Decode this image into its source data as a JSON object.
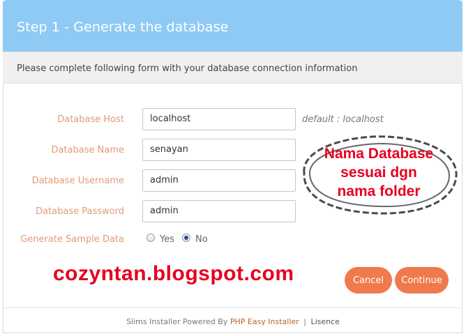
{
  "header": {
    "title": "Step 1 - Generate the database"
  },
  "subheader": {
    "text": "Please complete following form with your database connection information"
  },
  "form": {
    "db_host": {
      "label": "Database Host",
      "value": "localhost",
      "hint": "default : localhost"
    },
    "db_name": {
      "label": "Database Name",
      "value": "senayan"
    },
    "db_username": {
      "label": "Database Username",
      "value": "admin"
    },
    "db_password": {
      "label": "Database Password",
      "value": "admin"
    },
    "sample_data": {
      "label": "Generate Sample Data",
      "options": [
        "Yes",
        "No"
      ],
      "selected": "No"
    }
  },
  "buttons": {
    "cancel": "Cancel",
    "continue": "Continue"
  },
  "footer": {
    "prefix": "Slims Installer Powered By",
    "link": "PHP Easy Installer",
    "separator": "|",
    "license": "Lisence"
  },
  "annotation": {
    "lines": [
      "Nama Database",
      "sesuai dgn",
      "nama folder"
    ]
  },
  "watermark": "cozyntan.blogspot.com",
  "colors": {
    "header_bg": "#8fcaf5",
    "label": "#e39a76",
    "button": "#f07a4d",
    "annotation": "#e6001f",
    "radio_selected": "#1f4f88"
  }
}
